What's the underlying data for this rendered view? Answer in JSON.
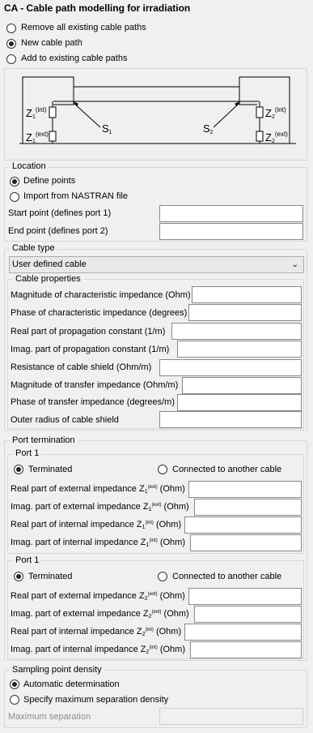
{
  "title": "CA - Cable path modelling for irradiation",
  "mode_options": [
    {
      "label": "Remove all existing cable paths",
      "selected": false
    },
    {
      "label": "New cable path",
      "selected": true
    },
    {
      "label": "Add to existing cable paths",
      "selected": false
    }
  ],
  "diagram": {
    "z1_int": "Z",
    "z1_int_sub": "1",
    "z1_int_sup": "(int)",
    "z1_ext": "Z",
    "z1_ext_sub": "1",
    "z1_ext_sup": "(ext)",
    "z2_int": "Z",
    "z2_int_sub": "2",
    "z2_int_sup": "(int)",
    "z2_ext": "Z",
    "z2_ext_sub": "2",
    "z2_ext_sup": "(ext)",
    "s1": "S",
    "s1_sub": "1",
    "s2": "S",
    "s2_sub": "2"
  },
  "location": {
    "legend": "Location",
    "options": [
      {
        "label": "Define points",
        "selected": true
      },
      {
        "label": "Import from NASTRAN file",
        "selected": false
      }
    ],
    "start_label": "Start point (defines port 1)",
    "start_value": "",
    "end_label": "End point (defines port 2)",
    "end_value": ""
  },
  "cable_type": {
    "legend": "Cable type",
    "selected": "User defined cable",
    "properties_legend": "Cable properties",
    "properties": [
      {
        "label": "Magnitude of characteristic impedance (Ohm)",
        "value": ""
      },
      {
        "label": "Phase of characteristic impedance (degrees)",
        "value": ""
      },
      {
        "label": "Real part of propagation constant (1/m)",
        "value": ""
      },
      {
        "label": "Imag. part of propagation constant (1/m)",
        "value": ""
      },
      {
        "label": "Resistance of cable shield (Ohm/m)",
        "value": ""
      },
      {
        "label": "Magnitude of transfer impedance (Ohm/m)",
        "value": ""
      },
      {
        "label": "Phase of transfer impedance (degrees/m)",
        "value": ""
      },
      {
        "label": "Outer radius of cable shield",
        "value": ""
      }
    ]
  },
  "port_termination": {
    "legend": "Port termination",
    "ports": [
      {
        "legend": "Port 1",
        "terminated_label": "Terminated",
        "connected_label": "Connected to another cable",
        "terminated_selected": true,
        "fields": [
          {
            "pre": "Real part of external impedance Z",
            "sub": "1",
            "sup": "(ext)",
            "post": " (Ohm)",
            "value": ""
          },
          {
            "pre": "Imag. part of external impedance Z",
            "sub": "1",
            "sup": "(ext)",
            "post": " (Ohm)",
            "value": ""
          },
          {
            "pre": "Real part of internal impedance Z",
            "sub": "1",
            "sup": "(int)",
            "post": " (Ohm)",
            "value": ""
          },
          {
            "pre": "Imag. part of internal impedance Z",
            "sub": "1",
            "sup": "(int)",
            "post": " (Ohm)",
            "value": ""
          }
        ]
      },
      {
        "legend": "Port 1",
        "terminated_label": "Terminated",
        "connected_label": "Connected to another cable",
        "terminated_selected": true,
        "fields": [
          {
            "pre": "Real part of external impedance Z",
            "sub": "2",
            "sup": "(ext)",
            "post": " (Ohm)",
            "value": ""
          },
          {
            "pre": "Imag. part of external impedance Z",
            "sub": "2",
            "sup": "(ext)",
            "post": " (Ohm)",
            "value": ""
          },
          {
            "pre": "Real part of internal impedance Z",
            "sub": "2",
            "sup": "(int)",
            "post": " (Ohm)",
            "value": ""
          },
          {
            "pre": "Imag. part of internal impedance Z",
            "sub": "2",
            "sup": "(int)",
            "post": " (Ohm)",
            "value": ""
          }
        ]
      }
    ]
  },
  "sampling": {
    "legend": "Sampling point density",
    "options": [
      {
        "label": "Automatic determination",
        "selected": true
      },
      {
        "label": "Specify maximum separation density",
        "selected": false
      }
    ],
    "max_sep_label": "Maximum separation",
    "max_sep_value": ""
  }
}
